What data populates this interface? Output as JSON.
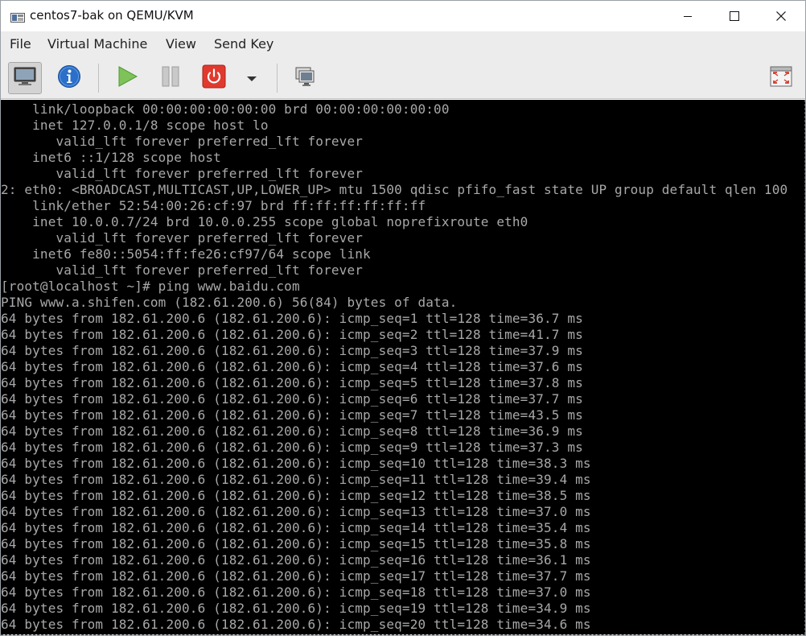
{
  "window": {
    "title": "centos7-bak on QEMU/KVM"
  },
  "menubar": {
    "items": [
      "File",
      "Virtual Machine",
      "View",
      "Send Key"
    ]
  },
  "toolbar": {
    "buttons": [
      "console-view",
      "details-info",
      "run",
      "pause",
      "shutdown",
      "shutdown-menu",
      "snapshots",
      "fullscreen"
    ]
  },
  "colors": {
    "console_bg": "#000000",
    "console_text": "#a8a8a8",
    "chrome_bg": "#ececec",
    "run_green": "#6dbb47",
    "shutdown_red": "#e03a2e",
    "info_blue": "#2a6fc9"
  },
  "console": {
    "lines": [
      "    link/loopback 00:00:00:00:00:00 brd 00:00:00:00:00:00",
      "    inet 127.0.0.1/8 scope host lo",
      "       valid_lft forever preferred_lft forever",
      "    inet6 ::1/128 scope host",
      "       valid_lft forever preferred_lft forever",
      "2: eth0: <BROADCAST,MULTICAST,UP,LOWER_UP> mtu 1500 qdisc pfifo_fast state UP group default qlen 100",
      "    link/ether 52:54:00:26:cf:97 brd ff:ff:ff:ff:ff:ff",
      "    inet 10.0.0.7/24 brd 10.0.0.255 scope global noprefixroute eth0",
      "       valid_lft forever preferred_lft forever",
      "    inet6 fe80::5054:ff:fe26:cf97/64 scope link",
      "       valid_lft forever preferred_lft forever",
      "[root@localhost ~]# ping www.baidu.com",
      "PING www.a.shifen.com (182.61.200.6) 56(84) bytes of data.",
      "64 bytes from 182.61.200.6 (182.61.200.6): icmp_seq=1 ttl=128 time=36.7 ms",
      "64 bytes from 182.61.200.6 (182.61.200.6): icmp_seq=2 ttl=128 time=41.7 ms",
      "64 bytes from 182.61.200.6 (182.61.200.6): icmp_seq=3 ttl=128 time=37.9 ms",
      "64 bytes from 182.61.200.6 (182.61.200.6): icmp_seq=4 ttl=128 time=37.6 ms",
      "64 bytes from 182.61.200.6 (182.61.200.6): icmp_seq=5 ttl=128 time=37.8 ms",
      "64 bytes from 182.61.200.6 (182.61.200.6): icmp_seq=6 ttl=128 time=37.7 ms",
      "64 bytes from 182.61.200.6 (182.61.200.6): icmp_seq=7 ttl=128 time=43.5 ms",
      "64 bytes from 182.61.200.6 (182.61.200.6): icmp_seq=8 ttl=128 time=36.9 ms",
      "64 bytes from 182.61.200.6 (182.61.200.6): icmp_seq=9 ttl=128 time=37.3 ms",
      "64 bytes from 182.61.200.6 (182.61.200.6): icmp_seq=10 ttl=128 time=38.3 ms",
      "64 bytes from 182.61.200.6 (182.61.200.6): icmp_seq=11 ttl=128 time=39.4 ms",
      "64 bytes from 182.61.200.6 (182.61.200.6): icmp_seq=12 ttl=128 time=38.5 ms",
      "64 bytes from 182.61.200.6 (182.61.200.6): icmp_seq=13 ttl=128 time=37.0 ms",
      "64 bytes from 182.61.200.6 (182.61.200.6): icmp_seq=14 ttl=128 time=35.4 ms",
      "64 bytes from 182.61.200.6 (182.61.200.6): icmp_seq=15 ttl=128 time=35.8 ms",
      "64 bytes from 182.61.200.6 (182.61.200.6): icmp_seq=16 ttl=128 time=36.1 ms",
      "64 bytes from 182.61.200.6 (182.61.200.6): icmp_seq=17 ttl=128 time=37.7 ms",
      "64 bytes from 182.61.200.6 (182.61.200.6): icmp_seq=18 ttl=128 time=37.0 ms",
      "64 bytes from 182.61.200.6 (182.61.200.6): icmp_seq=19 ttl=128 time=34.9 ms",
      "64 bytes from 182.61.200.6 (182.61.200.6): icmp_seq=20 ttl=128 time=34.6 ms"
    ]
  }
}
